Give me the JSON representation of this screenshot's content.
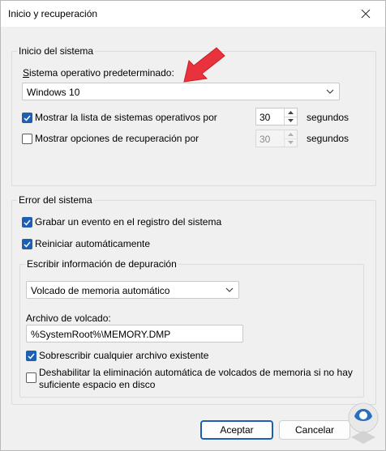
{
  "window": {
    "title": "Inicio y recuperación"
  },
  "icons": {
    "close": "close-icon",
    "chevron": "chevron-down-icon",
    "arrow": "red-arrow-icon",
    "watermark": "watermark-logo-icon"
  },
  "colors": {
    "accent": "#1d5fb5",
    "arrow": "#e8323c"
  },
  "startup": {
    "group_label": "Inicio del sistema",
    "default_os_label": "Sistema operativo predeterminado:",
    "default_os_value": "Windows 10",
    "show_list_label": "Mostrar la lista de sistemas operativos por",
    "show_list_checked": true,
    "show_list_value": "30",
    "show_recovery_label": "Mostrar opciones de recuperación por",
    "show_recovery_checked": false,
    "show_recovery_value": "30",
    "seconds_label_1": "segundos",
    "seconds_label_2": "segundos"
  },
  "failure": {
    "group_label": "Error del sistema",
    "log_event_label": "Grabar un evento en el registro del sistema",
    "log_event_checked": true,
    "auto_restart_label": "Reiniciar automáticamente",
    "auto_restart_checked": true,
    "debug": {
      "group_label": "Escribir información de depuración",
      "type_value": "Volcado de memoria automático",
      "dump_file_label": "Archivo de volcado:",
      "dump_file_value": "%SystemRoot%\\MEMORY.DMP",
      "overwrite_label": "Sobrescribir cualquier archivo existente",
      "overwrite_checked": true,
      "disable_auto_delete_label_line1": "Deshabilitar la eliminación automática de volcados de memoria si no hay",
      "disable_auto_delete_label_line2": "suficiente espacio en disco",
      "disable_auto_delete_checked": false
    }
  },
  "buttons": {
    "ok": "Aceptar",
    "cancel": "Cancelar"
  }
}
